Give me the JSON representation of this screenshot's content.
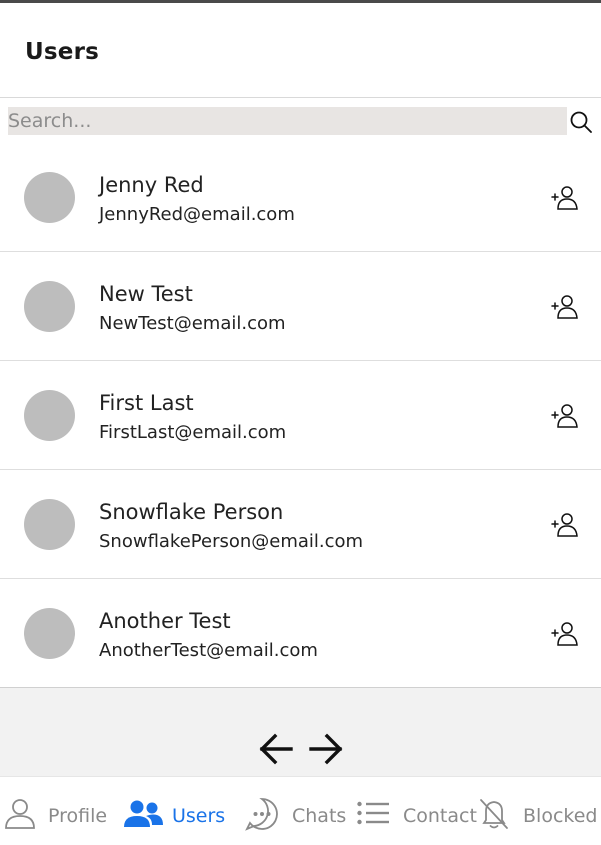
{
  "header": {
    "title": "Users"
  },
  "search": {
    "placeholder": "Search..."
  },
  "users": [
    {
      "name": "Jenny Red",
      "email": "JennyRed@email.com"
    },
    {
      "name": "New Test",
      "email": "NewTest@email.com"
    },
    {
      "name": "First Last",
      "email": "FirstLast@email.com"
    },
    {
      "name": "Snowflake Person",
      "email": "SnowflakePerson@email.com"
    },
    {
      "name": "Another Test",
      "email": "AnotherTest@email.com"
    }
  ],
  "nav": {
    "items": [
      {
        "label": "Profile",
        "icon": "user-icon",
        "active": false
      },
      {
        "label": "Users",
        "icon": "users-icon",
        "active": true
      },
      {
        "label": "Chats",
        "icon": "chat-icon",
        "active": false
      },
      {
        "label": "Contact",
        "icon": "list-icon",
        "active": false
      },
      {
        "label": "Blocked",
        "icon": "bell-off-icon",
        "active": false
      }
    ]
  },
  "colors": {
    "accent": "#1a73e8",
    "avatar": "#bdbdbd",
    "search_bg": "#e8e5e3"
  }
}
